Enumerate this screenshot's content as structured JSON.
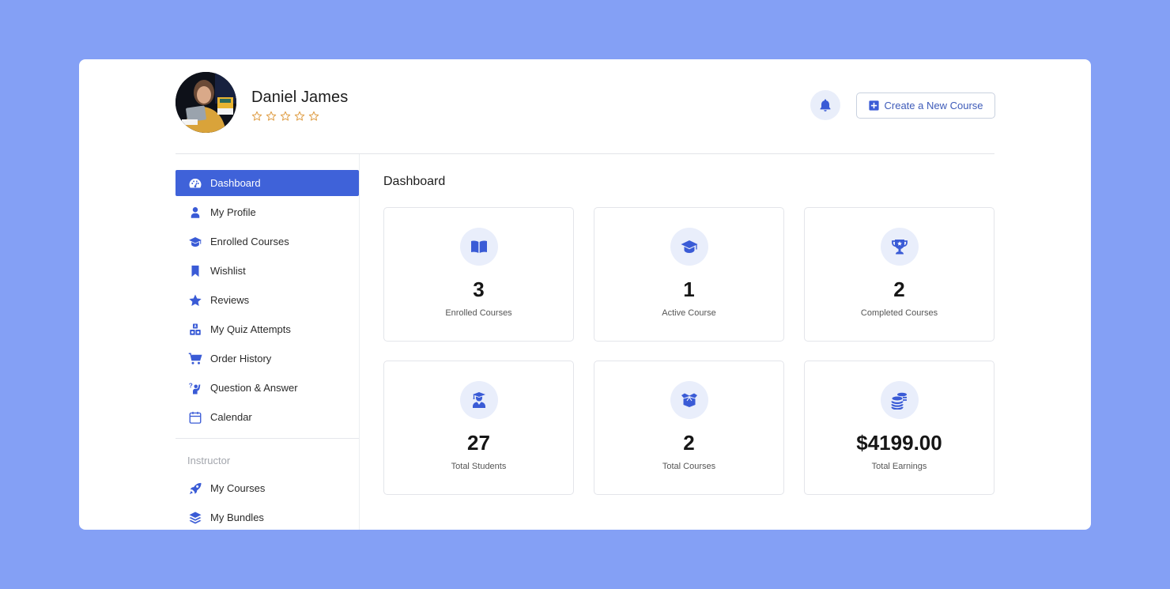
{
  "colors": {
    "background": "#84a0f5",
    "accent": "#3f62d9",
    "icon": "#3a5bd6",
    "icon_bg": "#e9eefb",
    "star": "#e0a04a"
  },
  "user": {
    "name": "Daniel James",
    "rating_stars": 5,
    "rating_value": 0,
    "avatar_icon": "user-photo"
  },
  "header": {
    "notification_icon": "bell-icon",
    "create_button_label": "Create a New Course",
    "create_button_icon": "plus-square-icon"
  },
  "sidebar": {
    "items": [
      {
        "label": "Dashboard",
        "icon": "dashboard-gauge-icon",
        "active": true
      },
      {
        "label": "My Profile",
        "icon": "user-icon"
      },
      {
        "label": "Enrolled Courses",
        "icon": "graduation-cap-icon"
      },
      {
        "label": "Wishlist",
        "icon": "bookmark-icon"
      },
      {
        "label": "Reviews",
        "icon": "star-icon"
      },
      {
        "label": "My Quiz Attempts",
        "icon": "quiz-blocks-icon"
      },
      {
        "label": "Order History",
        "icon": "cart-icon"
      },
      {
        "label": "Question & Answer",
        "icon": "question-person-icon"
      },
      {
        "label": "Calendar",
        "icon": "calendar-icon"
      }
    ],
    "instructor_section_label": "Instructor",
    "instructor_items": [
      {
        "label": "My Courses",
        "icon": "rocket-icon"
      },
      {
        "label": "My Bundles",
        "icon": "layers-icon"
      }
    ]
  },
  "main": {
    "title": "Dashboard",
    "stats": [
      {
        "value": "3",
        "label": "Enrolled Courses",
        "icon": "open-book-icon"
      },
      {
        "value": "1",
        "label": "Active Course",
        "icon": "graduation-cap-icon"
      },
      {
        "value": "2",
        "label": "Completed Courses",
        "icon": "trophy-icon"
      },
      {
        "value": "27",
        "label": "Total Students",
        "icon": "student-icon"
      },
      {
        "value": "2",
        "label": "Total Courses",
        "icon": "open-box-icon"
      },
      {
        "value": "$4199.00",
        "label": "Total Earnings",
        "icon": "coins-icon"
      }
    ]
  }
}
